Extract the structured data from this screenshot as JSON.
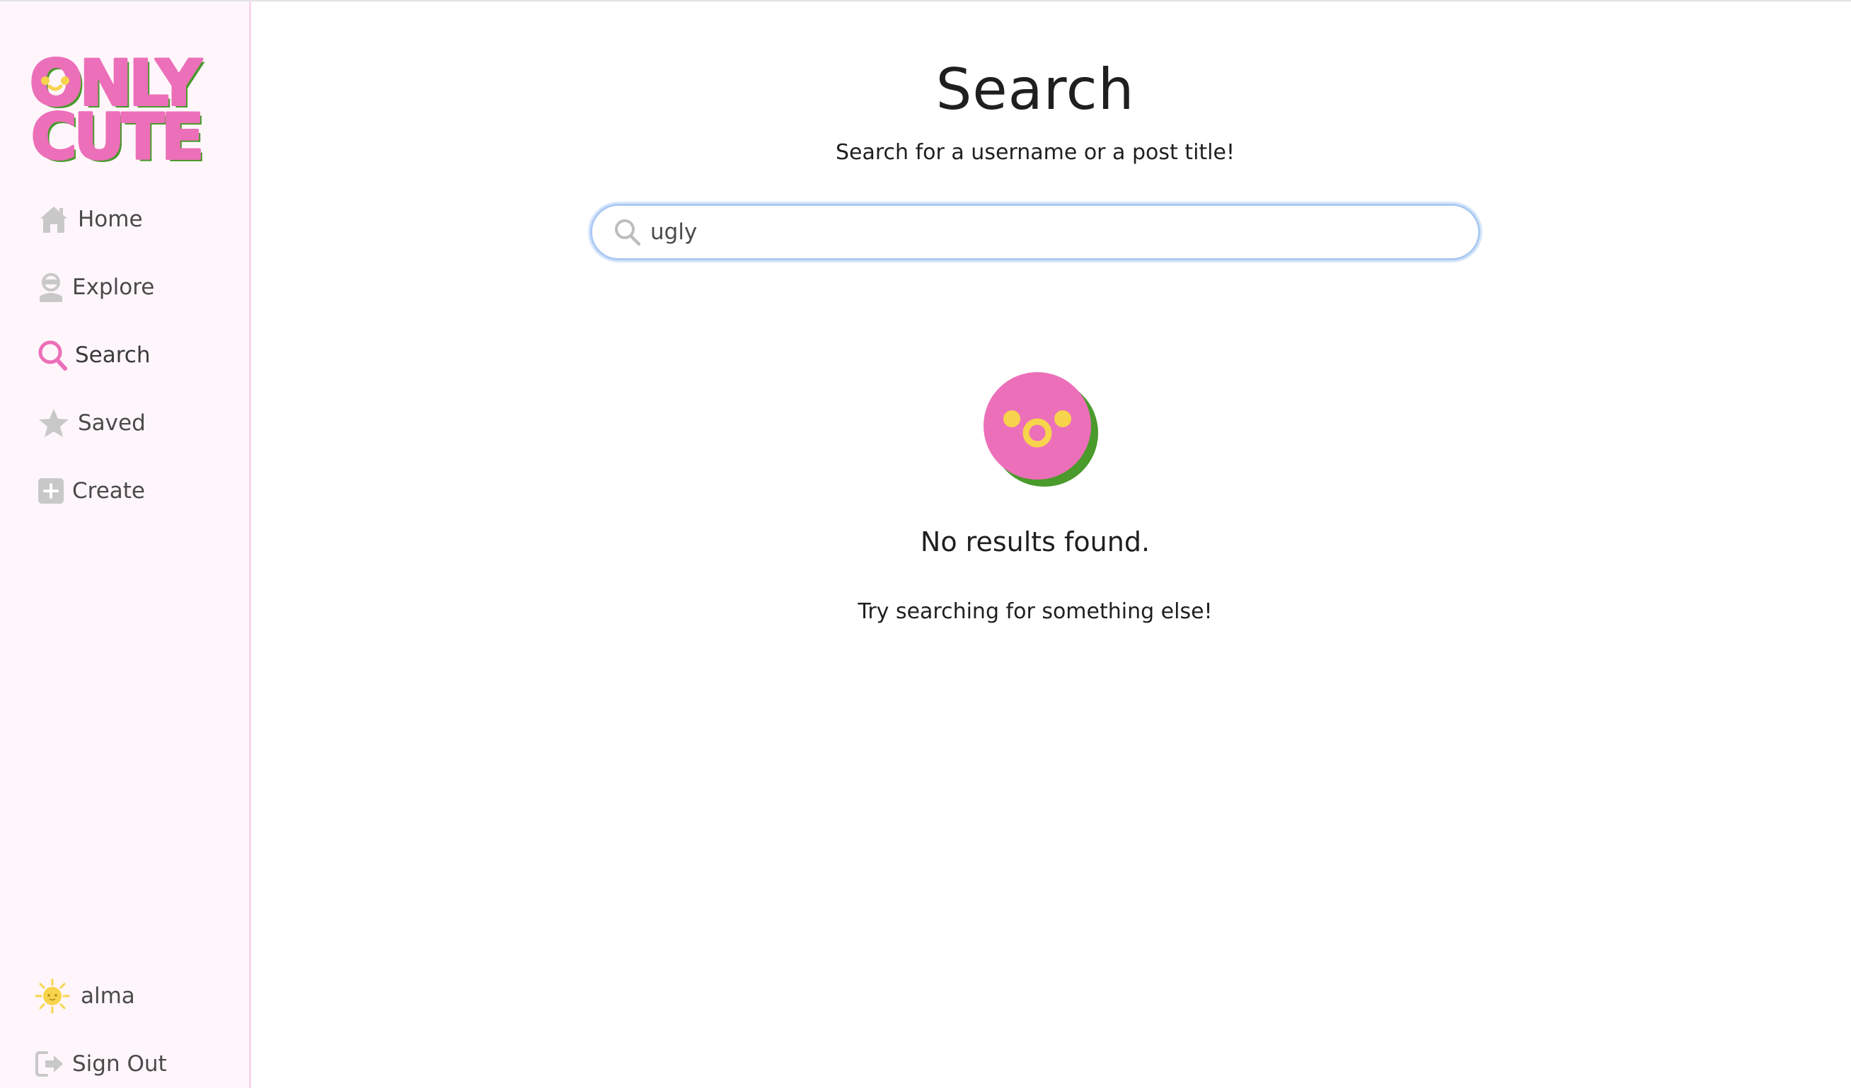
{
  "app": {
    "logo_text": "ONLY CUTE",
    "colors": {
      "brand_pink": "#ec6fb9",
      "brand_green": "#4a9a2c",
      "accent_yellow": "#f7d44c",
      "sidebar_bg": "#fff6fb",
      "icon_gray": "#c8c8c8",
      "focus_blue": "#a9c9f2"
    }
  },
  "sidebar": {
    "items": [
      {
        "label": "Home",
        "icon": "home-icon",
        "active": false
      },
      {
        "label": "Explore",
        "icon": "explore-icon",
        "active": false
      },
      {
        "label": "Search",
        "icon": "search-icon",
        "active": true
      },
      {
        "label": "Saved",
        "icon": "star-icon",
        "active": false
      },
      {
        "label": "Create",
        "icon": "plus-square-icon",
        "active": false
      }
    ],
    "user": {
      "name": "alma",
      "icon": "sun-avatar-icon"
    },
    "sign_out": {
      "label": "Sign Out",
      "icon": "sign-out-icon"
    }
  },
  "main": {
    "title": "Search",
    "subtitle": "Search for a username or a post title!",
    "search": {
      "value": "ugly",
      "icon": "search-icon"
    },
    "empty_state": {
      "icon": "surprised-face-icon",
      "title": "No results found.",
      "subtitle": "Try searching for something else!"
    }
  }
}
